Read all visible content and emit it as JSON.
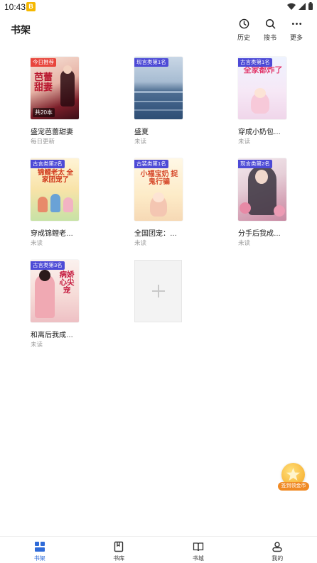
{
  "status_bar": {
    "time": "10:43",
    "notification": "B"
  },
  "header": {
    "title": "书架",
    "actions": [
      {
        "label": "历史",
        "icon": "clock-icon"
      },
      {
        "label": "搜书",
        "icon": "search-icon"
      },
      {
        "label": "更多",
        "icon": "more-icon"
      }
    ]
  },
  "books": [
    {
      "title": "盛宠芭蕾甜妻",
      "status": "每日更新",
      "tag": "今日推荐",
      "count": "共20本",
      "cover_text": "芭蕾甜妻",
      "accent": "#e8453c"
    },
    {
      "title": "盛夏",
      "status": "未读",
      "tag": "现言类第1名",
      "cover_text": "",
      "accent": "#4d4ad6"
    },
    {
      "title": "穿成小奶包…",
      "status": "未读",
      "tag": "古言类第1名",
      "cover_text": "全家都炸了",
      "accent": "#4d4ad6"
    },
    {
      "title": "穿成锦鲤老…",
      "status": "未读",
      "tag": "古言类第2名",
      "cover_text": "锦鲤老太 全家团宠了",
      "accent": "#4d4ad6"
    },
    {
      "title": "全国团宠：…",
      "status": "未读",
      "tag": "古装类第1名",
      "cover_text": "小福宝奶 捉鬼行骗",
      "accent": "#4d4ad6"
    },
    {
      "title": "分手后我成…",
      "status": "未读",
      "tag": "现言类第2名",
      "cover_text": "",
      "accent": "#4d4ad6"
    },
    {
      "title": "和离后我成…",
      "status": "未读",
      "tag": "古言类第3名",
      "cover_text": "病娇 心尖宠",
      "accent": "#4d4ad6"
    }
  ],
  "float_badge": {
    "label": "签到领金币"
  },
  "nav": [
    {
      "label": "书架",
      "icon": "bookshelf-icon",
      "active": true
    },
    {
      "label": "书库",
      "icon": "library-icon",
      "active": false
    },
    {
      "label": "书城",
      "icon": "bookstore-icon",
      "active": false
    },
    {
      "label": "我的",
      "icon": "profile-icon",
      "active": false
    }
  ],
  "colors": {
    "accent_blue": "#2f6bd8",
    "tag_purple": "#4d4ad6",
    "tag_red": "#e8453c"
  }
}
